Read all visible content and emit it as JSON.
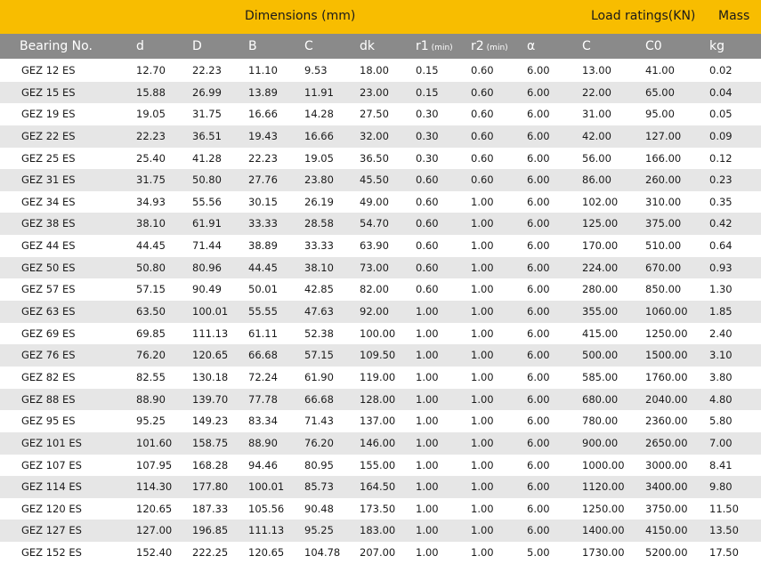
{
  "groups": {
    "dimensions": "Dimensions (mm)",
    "load": "Load ratings(KN)",
    "mass": "Mass"
  },
  "columns": [
    {
      "label": "Bearing No.",
      "sub": ""
    },
    {
      "label": "d",
      "sub": ""
    },
    {
      "label": "D",
      "sub": ""
    },
    {
      "label": "B",
      "sub": ""
    },
    {
      "label": "C",
      "sub": ""
    },
    {
      "label": "dk",
      "sub": ""
    },
    {
      "label": "r1",
      "sub": "(min)"
    },
    {
      "label": "r2",
      "sub": "(min)"
    },
    {
      "label": "α",
      "sub": ""
    },
    {
      "label": "C",
      "sub": ""
    },
    {
      "label": "C0",
      "sub": ""
    },
    {
      "label": "kg",
      "sub": ""
    }
  ],
  "rows": [
    [
      "GEZ 12 ES",
      "12.70",
      "22.23",
      "11.10",
      "9.53",
      "18.00",
      "0.15",
      "0.60",
      "6.00",
      "13.00",
      "41.00",
      "0.02"
    ],
    [
      "GEZ 15 ES",
      "15.88",
      "26.99",
      "13.89",
      "11.91",
      "23.00",
      "0.15",
      "0.60",
      "6.00",
      "22.00",
      "65.00",
      "0.04"
    ],
    [
      "GEZ 19 ES",
      "19.05",
      "31.75",
      "16.66",
      "14.28",
      "27.50",
      "0.30",
      "0.60",
      "6.00",
      "31.00",
      "95.00",
      "0.05"
    ],
    [
      "GEZ 22 ES",
      "22.23",
      "36.51",
      "19.43",
      "16.66",
      "32.00",
      "0.30",
      "0.60",
      "6.00",
      "42.00",
      "127.00",
      "0.09"
    ],
    [
      "GEZ 25 ES",
      "25.40",
      "41.28",
      "22.23",
      "19.05",
      "36.50",
      "0.30",
      "0.60",
      "6.00",
      "56.00",
      "166.00",
      "0.12"
    ],
    [
      "GEZ 31 ES",
      "31.75",
      "50.80",
      "27.76",
      "23.80",
      "45.50",
      "0.60",
      "0.60",
      "6.00",
      "86.00",
      "260.00",
      "0.23"
    ],
    [
      "GEZ 34 ES",
      "34.93",
      "55.56",
      "30.15",
      "26.19",
      "49.00",
      "0.60",
      "1.00",
      "6.00",
      "102.00",
      "310.00",
      "0.35"
    ],
    [
      "GEZ 38 ES",
      "38.10",
      "61.91",
      "33.33",
      "28.58",
      "54.70",
      "0.60",
      "1.00",
      "6.00",
      "125.00",
      "375.00",
      "0.42"
    ],
    [
      "GEZ 44 ES",
      "44.45",
      "71.44",
      "38.89",
      "33.33",
      "63.90",
      "0.60",
      "1.00",
      "6.00",
      "170.00",
      "510.00",
      "0.64"
    ],
    [
      "GEZ 50 ES",
      "50.80",
      "80.96",
      "44.45",
      "38.10",
      "73.00",
      "0.60",
      "1.00",
      "6.00",
      "224.00",
      "670.00",
      "0.93"
    ],
    [
      "GEZ 57 ES",
      "57.15",
      "90.49",
      "50.01",
      "42.85",
      "82.00",
      "0.60",
      "1.00",
      "6.00",
      "280.00",
      "850.00",
      "1.30"
    ],
    [
      "GEZ 63 ES",
      "63.50",
      "100.01",
      "55.55",
      "47.63",
      "92.00",
      "1.00",
      "1.00",
      "6.00",
      "355.00",
      "1060.00",
      "1.85"
    ],
    [
      "GEZ 69 ES",
      "69.85",
      "111.13",
      "61.11",
      "52.38",
      "100.00",
      "1.00",
      "1.00",
      "6.00",
      "415.00",
      "1250.00",
      "2.40"
    ],
    [
      "GEZ 76 ES",
      "76.20",
      "120.65",
      "66.68",
      "57.15",
      "109.50",
      "1.00",
      "1.00",
      "6.00",
      "500.00",
      "1500.00",
      "3.10"
    ],
    [
      "GEZ 82 ES",
      "82.55",
      "130.18",
      "72.24",
      "61.90",
      "119.00",
      "1.00",
      "1.00",
      "6.00",
      "585.00",
      "1760.00",
      "3.80"
    ],
    [
      "GEZ 88 ES",
      "88.90",
      "139.70",
      "77.78",
      "66.68",
      "128.00",
      "1.00",
      "1.00",
      "6.00",
      "680.00",
      "2040.00",
      "4.80"
    ],
    [
      "GEZ 95 ES",
      "95.25",
      "149.23",
      "83.34",
      "71.43",
      "137.00",
      "1.00",
      "1.00",
      "6.00",
      "780.00",
      "2360.00",
      "5.80"
    ],
    [
      "GEZ 101 ES",
      "101.60",
      "158.75",
      "88.90",
      "76.20",
      "146.00",
      "1.00",
      "1.00",
      "6.00",
      "900.00",
      "2650.00",
      "7.00"
    ],
    [
      "GEZ 107 ES",
      "107.95",
      "168.28",
      "94.46",
      "80.95",
      "155.00",
      "1.00",
      "1.00",
      "6.00",
      "1000.00",
      "3000.00",
      "8.41"
    ],
    [
      "GEZ 114 ES",
      "114.30",
      "177.80",
      "100.01",
      "85.73",
      "164.50",
      "1.00",
      "1.00",
      "6.00",
      "1120.00",
      "3400.00",
      "9.80"
    ],
    [
      "GEZ 120 ES",
      "120.65",
      "187.33",
      "105.56",
      "90.48",
      "173.50",
      "1.00",
      "1.00",
      "6.00",
      "1250.00",
      "3750.00",
      "11.50"
    ],
    [
      "GEZ 127 ES",
      "127.00",
      "196.85",
      "111.13",
      "95.25",
      "183.00",
      "1.00",
      "1.00",
      "6.00",
      "1400.00",
      "4150.00",
      "13.50"
    ],
    [
      "GEZ 152 ES",
      "152.40",
      "222.25",
      "120.65",
      "104.78",
      "207.00",
      "1.00",
      "1.00",
      "5.00",
      "1730.00",
      "5200.00",
      "17.50"
    ]
  ],
  "colors": {
    "group_header_bg": "#f8bd00",
    "column_header_bg": "#8a8a8a",
    "alt_row_bg": "#e6e6e6"
  }
}
